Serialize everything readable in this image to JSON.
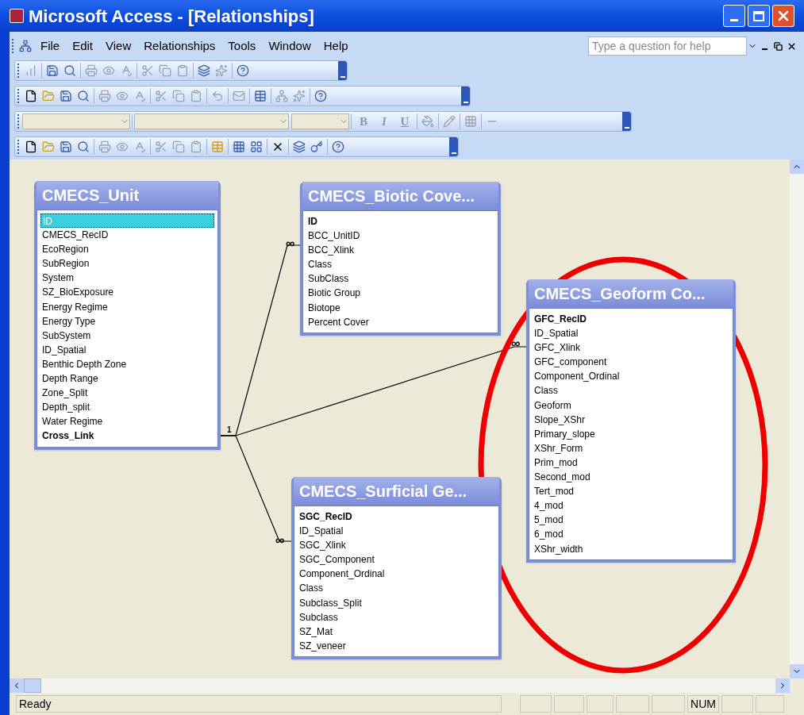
{
  "window": {
    "title": "Microsoft Access - [Relationships]"
  },
  "menu": [
    "File",
    "Edit",
    "View",
    "Relationships",
    "Tools",
    "Window",
    "Help"
  ],
  "help_box": {
    "placeholder": "Type a question for help"
  },
  "format_toolbar": {
    "buttons": [
      "B",
      "I",
      "U"
    ]
  },
  "tables": [
    {
      "title": "CMECS_Unit",
      "fields": [
        {
          "name": "ID",
          "key": false,
          "selected": true
        },
        {
          "name": "CMECS_RecID",
          "key": false,
          "selected": false
        },
        {
          "name": "EcoRegion",
          "key": false,
          "selected": false
        },
        {
          "name": "SubRegion",
          "key": false,
          "selected": false
        },
        {
          "name": "System",
          "key": false,
          "selected": false
        },
        {
          "name": "SZ_BioExposure",
          "key": false,
          "selected": false
        },
        {
          "name": "Energy Regime",
          "key": false,
          "selected": false
        },
        {
          "name": "Energy Type",
          "key": false,
          "selected": false
        },
        {
          "name": "SubSystem",
          "key": false,
          "selected": false
        },
        {
          "name": "ID_Spatial",
          "key": false,
          "selected": false
        },
        {
          "name": "Benthic Depth Zone",
          "key": false,
          "selected": false
        },
        {
          "name": "Depth Range",
          "key": false,
          "selected": false
        },
        {
          "name": "Zone_Split",
          "key": false,
          "selected": false
        },
        {
          "name": "Depth_split",
          "key": false,
          "selected": false
        },
        {
          "name": "Water Regime",
          "key": false,
          "selected": false
        },
        {
          "name": "Cross_Link",
          "key": true,
          "selected": false
        }
      ]
    },
    {
      "title": "CMECS_Biotic Cove...",
      "fields": [
        {
          "name": "ID",
          "key": true,
          "selected": false
        },
        {
          "name": "BCC_UnitID",
          "key": false,
          "selected": false
        },
        {
          "name": "BCC_Xlink",
          "key": false,
          "selected": false
        },
        {
          "name": "Class",
          "key": false,
          "selected": false
        },
        {
          "name": "SubClass",
          "key": false,
          "selected": false
        },
        {
          "name": "Biotic Group",
          "key": false,
          "selected": false
        },
        {
          "name": "Biotope",
          "key": false,
          "selected": false
        },
        {
          "name": "Percent Cover",
          "key": false,
          "selected": false
        }
      ]
    },
    {
      "title": "CMECS_Geoform Co...",
      "fields": [
        {
          "name": "GFC_RecID",
          "key": true,
          "selected": false
        },
        {
          "name": "ID_Spatial",
          "key": false,
          "selected": false
        },
        {
          "name": "GFC_Xlink",
          "key": false,
          "selected": false
        },
        {
          "name": "GFC_component",
          "key": false,
          "selected": false
        },
        {
          "name": "Component_Ordinal",
          "key": false,
          "selected": false
        },
        {
          "name": "Class",
          "key": false,
          "selected": false
        },
        {
          "name": "Geoform",
          "key": false,
          "selected": false
        },
        {
          "name": "Slope_XShr",
          "key": false,
          "selected": false
        },
        {
          "name": "Primary_slope",
          "key": false,
          "selected": false
        },
        {
          "name": "XShr_Form",
          "key": false,
          "selected": false
        },
        {
          "name": "Prim_mod",
          "key": false,
          "selected": false
        },
        {
          "name": "Second_mod",
          "key": false,
          "selected": false
        },
        {
          "name": "Tert_mod",
          "key": false,
          "selected": false
        },
        {
          "name": "4_mod",
          "key": false,
          "selected": false
        },
        {
          "name": "5_mod",
          "key": false,
          "selected": false
        },
        {
          "name": "6_mod",
          "key": false,
          "selected": false
        },
        {
          "name": "XShr_width",
          "key": false,
          "selected": false
        }
      ]
    },
    {
      "title": "CMECS_Surficial Ge...",
      "fields": [
        {
          "name": "SGC_RecID",
          "key": true,
          "selected": false
        },
        {
          "name": "ID_Spatial",
          "key": false,
          "selected": false
        },
        {
          "name": "SGC_Xlink",
          "key": false,
          "selected": false
        },
        {
          "name": "SGC_Component",
          "key": false,
          "selected": false
        },
        {
          "name": "Component_Ordinal",
          "key": false,
          "selected": false
        },
        {
          "name": "Class",
          "key": false,
          "selected": false
        },
        {
          "name": "Subclass_Split",
          "key": false,
          "selected": false
        },
        {
          "name": "Subclass",
          "key": false,
          "selected": false
        },
        {
          "name": "SZ_Mat",
          "key": false,
          "selected": false
        },
        {
          "name": "SZ_veneer",
          "key": false,
          "selected": false
        }
      ]
    }
  ],
  "relationships": [
    {
      "one_label": "1",
      "many_label": "∞"
    },
    {
      "many_label": "∞"
    },
    {
      "many_label": "∞"
    }
  ],
  "status_bar": {
    "text": "Ready",
    "panels": [
      "NUM"
    ]
  }
}
